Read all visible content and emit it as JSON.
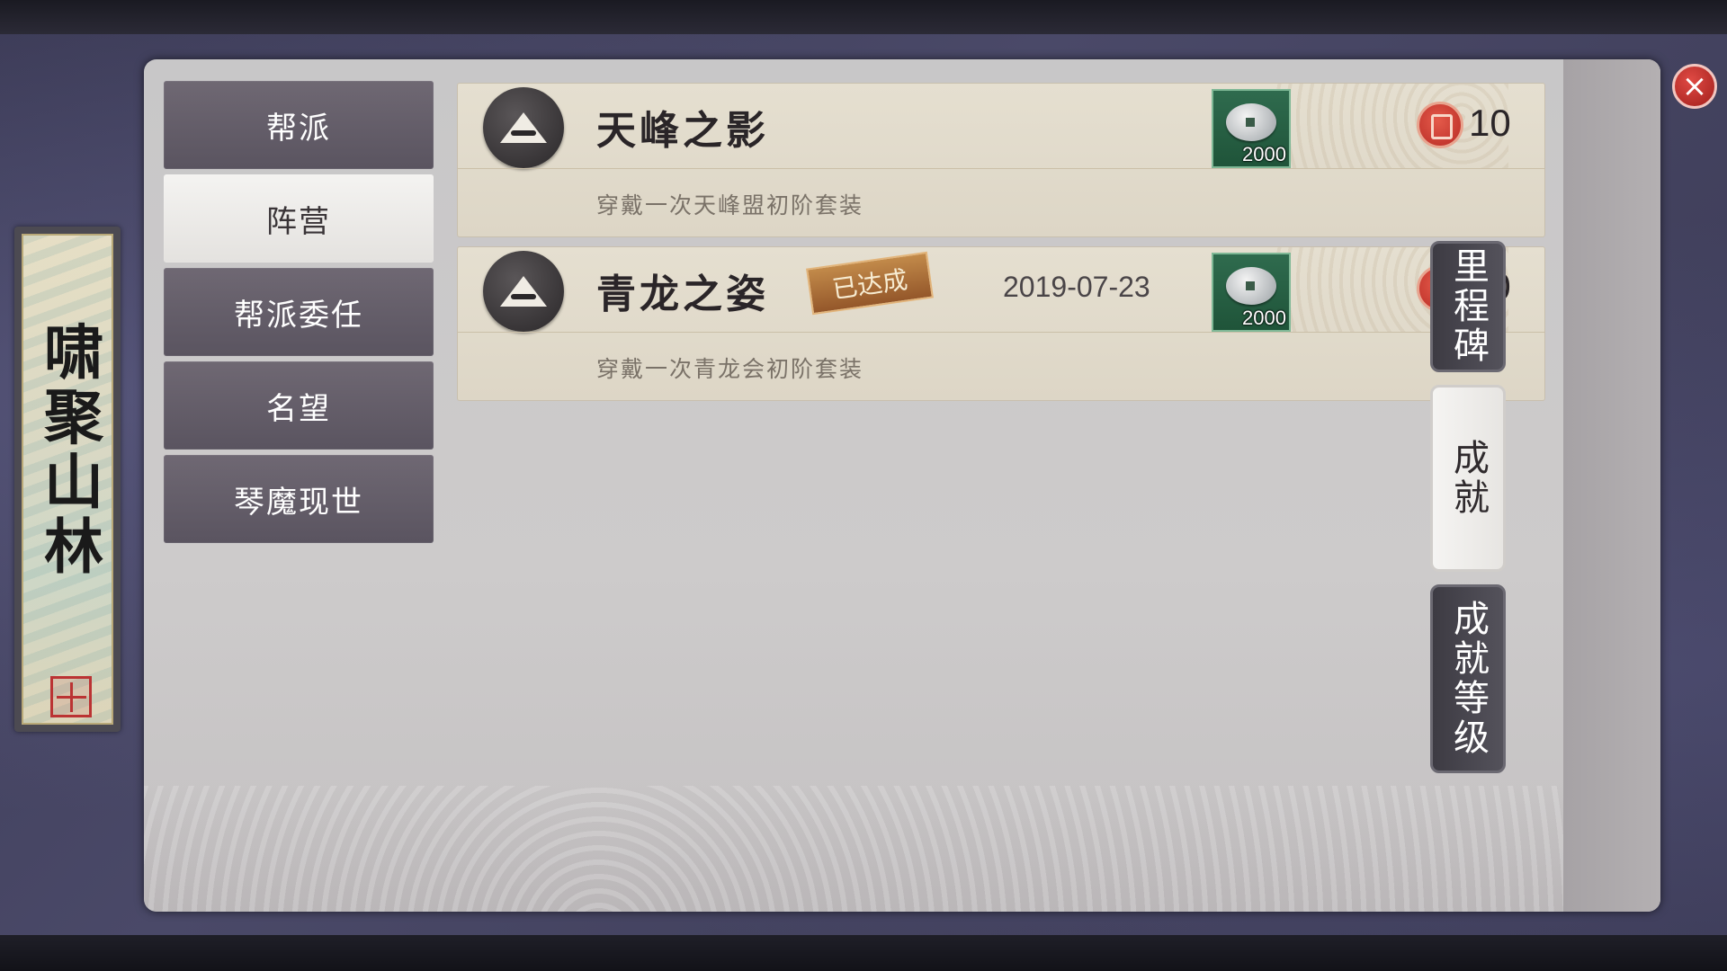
{
  "banner": {
    "title": "啸聚山林"
  },
  "categories": [
    {
      "label": "帮派",
      "active": false
    },
    {
      "label": "阵营",
      "active": true
    },
    {
      "label": "帮派委任",
      "active": false
    },
    {
      "label": "名望",
      "active": false
    },
    {
      "label": "琴魔现世",
      "active": false
    }
  ],
  "achievements": [
    {
      "name": "天峰之影",
      "description": "穿戴一次天峰盟初阶套装",
      "completed": false,
      "badge": "",
      "date": "",
      "reward": {
        "icon": "silver-coin-icon",
        "count": "2000"
      },
      "points": "10"
    },
    {
      "name": "青龙之姿",
      "description": "穿戴一次青龙会初阶套装",
      "completed": true,
      "badge": "已达成",
      "date": "2019-07-23",
      "reward": {
        "icon": "silver-coin-icon",
        "count": "2000"
      },
      "points": "10"
    }
  ],
  "side_tabs": [
    {
      "label": "里程碑",
      "active": false
    },
    {
      "label": "成就",
      "active": true
    },
    {
      "label": "成就等级",
      "active": false
    }
  ],
  "close": {
    "label": "×"
  }
}
